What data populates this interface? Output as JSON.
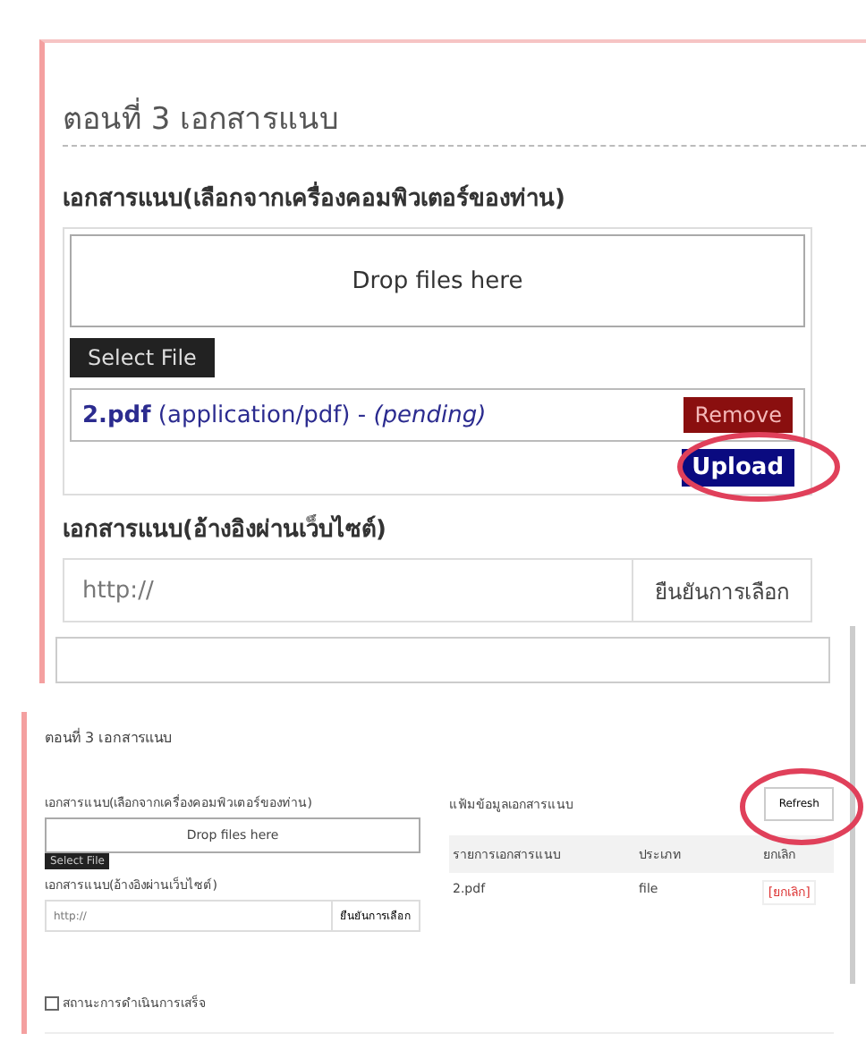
{
  "section_title": "ตอนที่ 3 เอกสารแนบ",
  "upload": {
    "label": "เอกสารแนบ(เลือกจากเครื่องคอมพิวเตอร์ของท่าน)",
    "dropzone": "Drop files here",
    "select_button": "Select File",
    "upload_button": {
      "label": "Upload",
      "circled": true
    },
    "files": [
      {
        "name": "2.pdf",
        "type": "(application/pdf)",
        "separator": "-",
        "status": "(pending)",
        "remove": "Remove"
      }
    ]
  },
  "url": {
    "label": "เอกสารแนบ(อ้างอิงผ่านเว็บไซต์)",
    "placeholder": "http://",
    "confirm": "ยืนยันการเลือก"
  },
  "preview": {
    "section_title": "ตอนที่ 3 เอกสารแนบ",
    "upload_label": "เอกสารแนบ(เลือกจากเครื่องคอมพิวเตอร์ของท่าน)",
    "dropzone": "Drop files here",
    "select_button": "Select File",
    "url_label": "เอกสารแนบ(อ้างอิงผ่านเว็บไซต์)",
    "url_placeholder": "http://",
    "confirm": "ยืนยันการเลือก",
    "list_title": "แฟ้มข้อมูลเอกสารแนบ",
    "refresh": {
      "label": "Refresh",
      "circled": true
    },
    "columns": [
      "รายการเอกสารแนบ",
      "ประเภท",
      "ยกเลิก"
    ],
    "rows": [
      {
        "cells": [
          "2.pdf",
          "file"
        ],
        "action": "[ยกเลิก]"
      }
    ],
    "checkbox": {
      "label": "สถานะการดำเนินการเสร็จ",
      "checked": false
    }
  }
}
